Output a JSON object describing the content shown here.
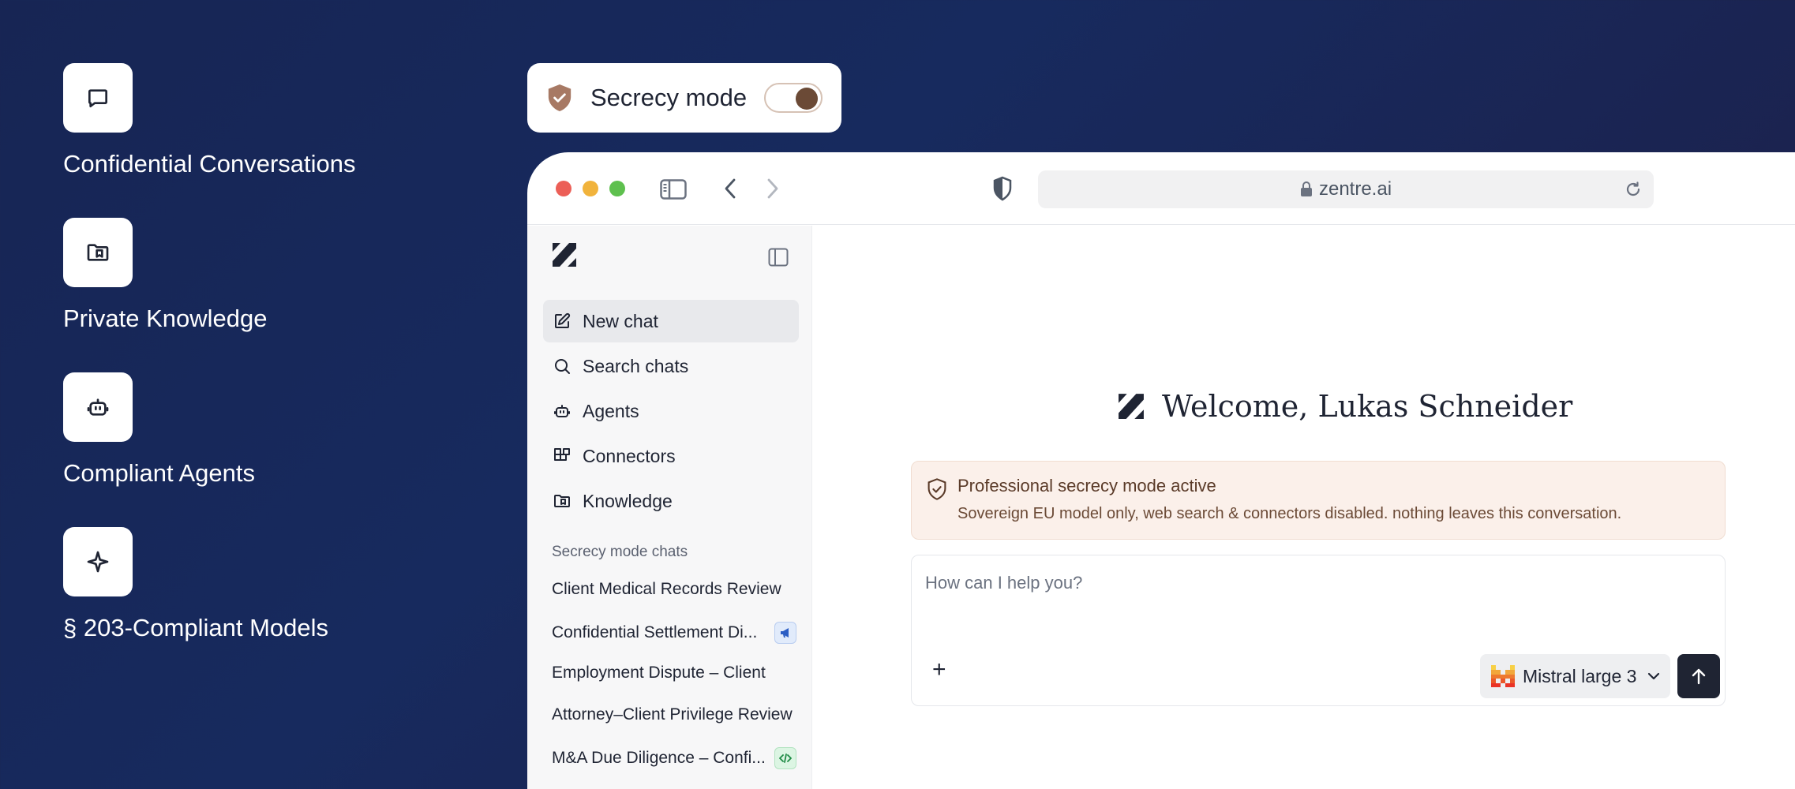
{
  "features": [
    {
      "icon": "chat-bubble-icon",
      "label": "Confidential Conversations"
    },
    {
      "icon": "knowledge-folder-icon",
      "label": "Private Knowledge"
    },
    {
      "icon": "robot-icon",
      "label": "Compliant Agents"
    },
    {
      "icon": "sparkle-icon",
      "label": "§ 203-Compliant Models"
    }
  ],
  "secrecy_toggle": {
    "label": "Secrecy mode",
    "enabled": true
  },
  "browser": {
    "url": "zentre.ai"
  },
  "sidebar": {
    "nav": [
      {
        "icon": "edit-icon",
        "label": "New chat",
        "active": true
      },
      {
        "icon": "search-icon",
        "label": "Search chats"
      },
      {
        "icon": "robot-icon",
        "label": "Agents"
      },
      {
        "icon": "connectors-icon",
        "label": "Connectors"
      },
      {
        "icon": "knowledge-folder-icon",
        "label": "Knowledge"
      }
    ],
    "section_title": "Secrecy mode chats",
    "chats": [
      {
        "label": "Client Medical Records Review"
      },
      {
        "label": "Confidential Settlement Di...",
        "badge": "megaphone-icon"
      },
      {
        "label": "Employment Dispute – Client"
      },
      {
        "label": "Attorney–Client Privilege Review"
      },
      {
        "label": "M&A Due Diligence – Confi...",
        "badge": "code-icon"
      }
    ]
  },
  "main": {
    "welcome": "Welcome, Lukas Schneider",
    "notice_title": "Professional secrecy mode active",
    "notice_body": "Sovereign EU model only, web search & connectors disabled. nothing leaves this conversation.",
    "composer_placeholder": "How can I help you?",
    "model": "Mistral large 3"
  },
  "colors": {
    "accent": "#6b4a36",
    "notice_bg": "#fbf0ea",
    "send_button": "#1f2433"
  }
}
